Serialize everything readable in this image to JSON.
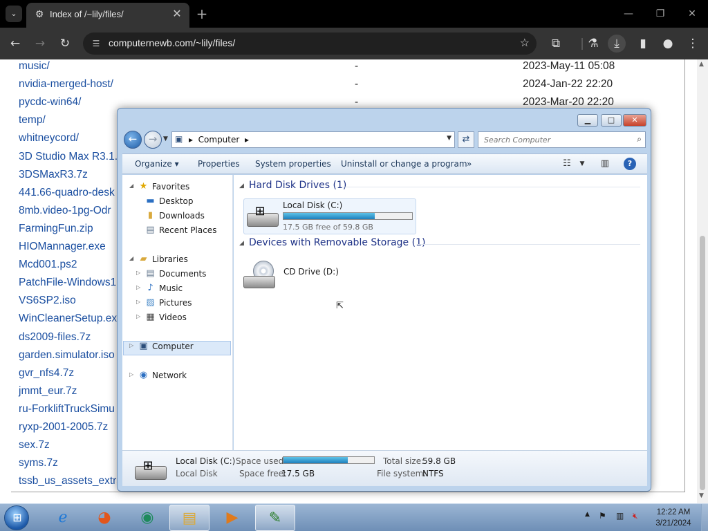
{
  "browser": {
    "tab_title": "Index of /~lily/files/",
    "url": "computernewb.com/~lily/files/"
  },
  "listing": [
    {
      "name": "music/",
      "size": "-",
      "date": "2023-May-11 05:08"
    },
    {
      "name": "nvidia-merged-host/",
      "size": "-",
      "date": "2024-Jan-22 22:20"
    },
    {
      "name": "pycdc-win64/",
      "size": "-",
      "date": "2023-Mar-20 22:20"
    },
    {
      "name": "temp/",
      "size": "",
      "date": ""
    },
    {
      "name": "whitneycord/",
      "size": "",
      "date": ""
    },
    {
      "name": "3D Studio Max R3.1.",
      "size": "",
      "date": ""
    },
    {
      "name": "3DSMaxR3.7z",
      "size": "",
      "date": ""
    },
    {
      "name": "441.66-quadro-desk",
      "size": "",
      "date": ""
    },
    {
      "name": "8mb.video-1pg-Odr",
      "size": "",
      "date": ""
    },
    {
      "name": "FarmingFun.zip",
      "size": "",
      "date": ""
    },
    {
      "name": "HIOMannager.exe",
      "size": "",
      "date": ""
    },
    {
      "name": "Mcd001.ps2",
      "size": "",
      "date": ""
    },
    {
      "name": "PatchFile-Windows1",
      "size": "",
      "date": ""
    },
    {
      "name": "VS6SP2.iso",
      "size": "",
      "date": ""
    },
    {
      "name": "WinCleanerSetup.ex",
      "size": "",
      "date": ""
    },
    {
      "name": "ds2009-files.7z",
      "size": "",
      "date": ""
    },
    {
      "name": "garden.simulator.iso",
      "size": "",
      "date": ""
    },
    {
      "name": "gvr_nfs4.7z",
      "size": "",
      "date": ""
    },
    {
      "name": "jmmt_eur.7z",
      "size": "",
      "date": ""
    },
    {
      "name": "ru-ForkliftTruckSimu",
      "size": "",
      "date": ""
    },
    {
      "name": "ryxp-2001-2005.7z",
      "size": "",
      "date": ""
    },
    {
      "name": "sex.7z",
      "size": "",
      "date": ""
    },
    {
      "name": "syms.7z",
      "size": "",
      "date": ""
    },
    {
      "name": "tssb_us_assets_extra",
      "size": "",
      "date": ""
    }
  ],
  "explorer": {
    "address_segment": "Computer",
    "search_placeholder": "Search Computer",
    "commands": {
      "organize": "Organize",
      "properties": "Properties",
      "system_properties": "System properties",
      "uninstall": "Uninstall or change a program",
      "more": "»"
    },
    "nav": {
      "favorites": "Favorites",
      "desktop": "Desktop",
      "downloads": "Downloads",
      "recent_places": "Recent Places",
      "libraries": "Libraries",
      "documents": "Documents",
      "music": "Music",
      "pictures": "Pictures",
      "videos": "Videos",
      "computer": "Computer",
      "network": "Network"
    },
    "groups": {
      "hdd": "Hard Disk Drives (1)",
      "removable": "Devices with Removable Storage (1)"
    },
    "local_disk": {
      "name": "Local Disk (C:)",
      "free_text": "17.5 GB free of 59.8 GB",
      "used_fraction": 0.707
    },
    "cd_drive": {
      "name": "CD Drive (D:)"
    },
    "details": {
      "name": "Local Disk (C:)",
      "type": "Local Disk",
      "space_used_label": "Space used:",
      "space_free_label": "Space free:",
      "space_free": "17.5 GB",
      "total_size_label": "Total size:",
      "total_size": "59.8 GB",
      "file_system_label": "File system:",
      "file_system": "NTFS"
    }
  },
  "taskbar": {
    "time": "12:22 AM",
    "date": "3/21/2024"
  }
}
